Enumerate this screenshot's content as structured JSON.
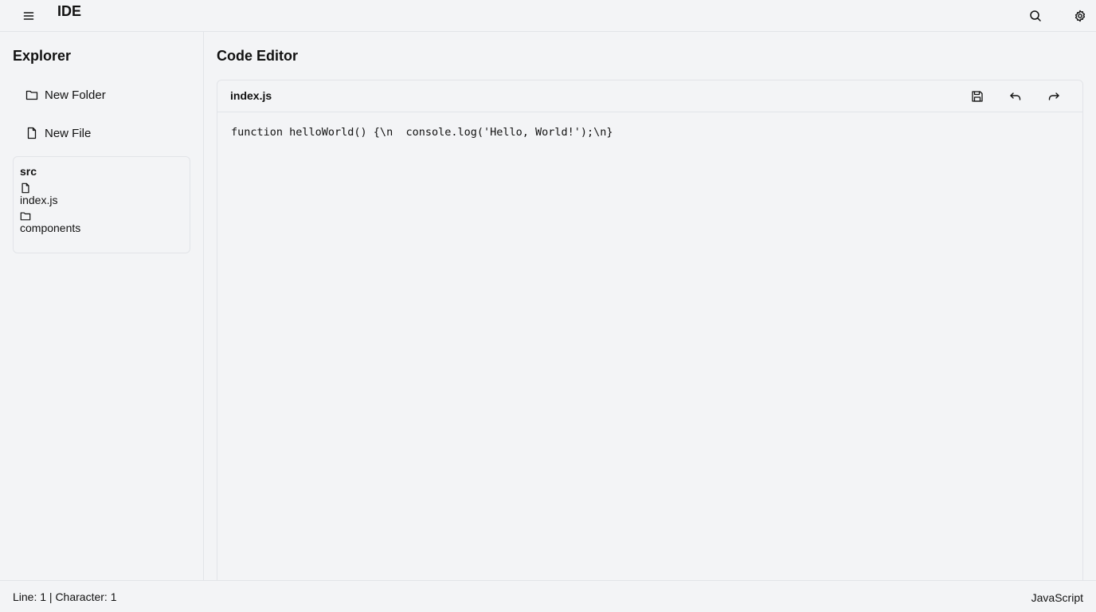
{
  "header": {
    "title": "IDE",
    "menu_icon": "menu-icon",
    "search_icon": "search-icon",
    "settings_icon": "gear-icon"
  },
  "sidebar": {
    "title": "Explorer",
    "new_folder_label": "New Folder",
    "new_file_label": "New File",
    "tree": {
      "root": "src",
      "items": [
        {
          "label": "index.js",
          "icon": "file-icon"
        },
        {
          "label": "components",
          "icon": "folder-icon"
        }
      ]
    }
  },
  "main": {
    "title": "Code Editor",
    "editor": {
      "filename": "index.js",
      "code": "function helloWorld() {\\n  console.log('Hello, World!');\\n}",
      "toolbar_icons": [
        "save-icon",
        "undo-icon",
        "redo-icon"
      ]
    }
  },
  "status": {
    "position": "Line: 1 | Character: 1",
    "language": "JavaScript"
  }
}
